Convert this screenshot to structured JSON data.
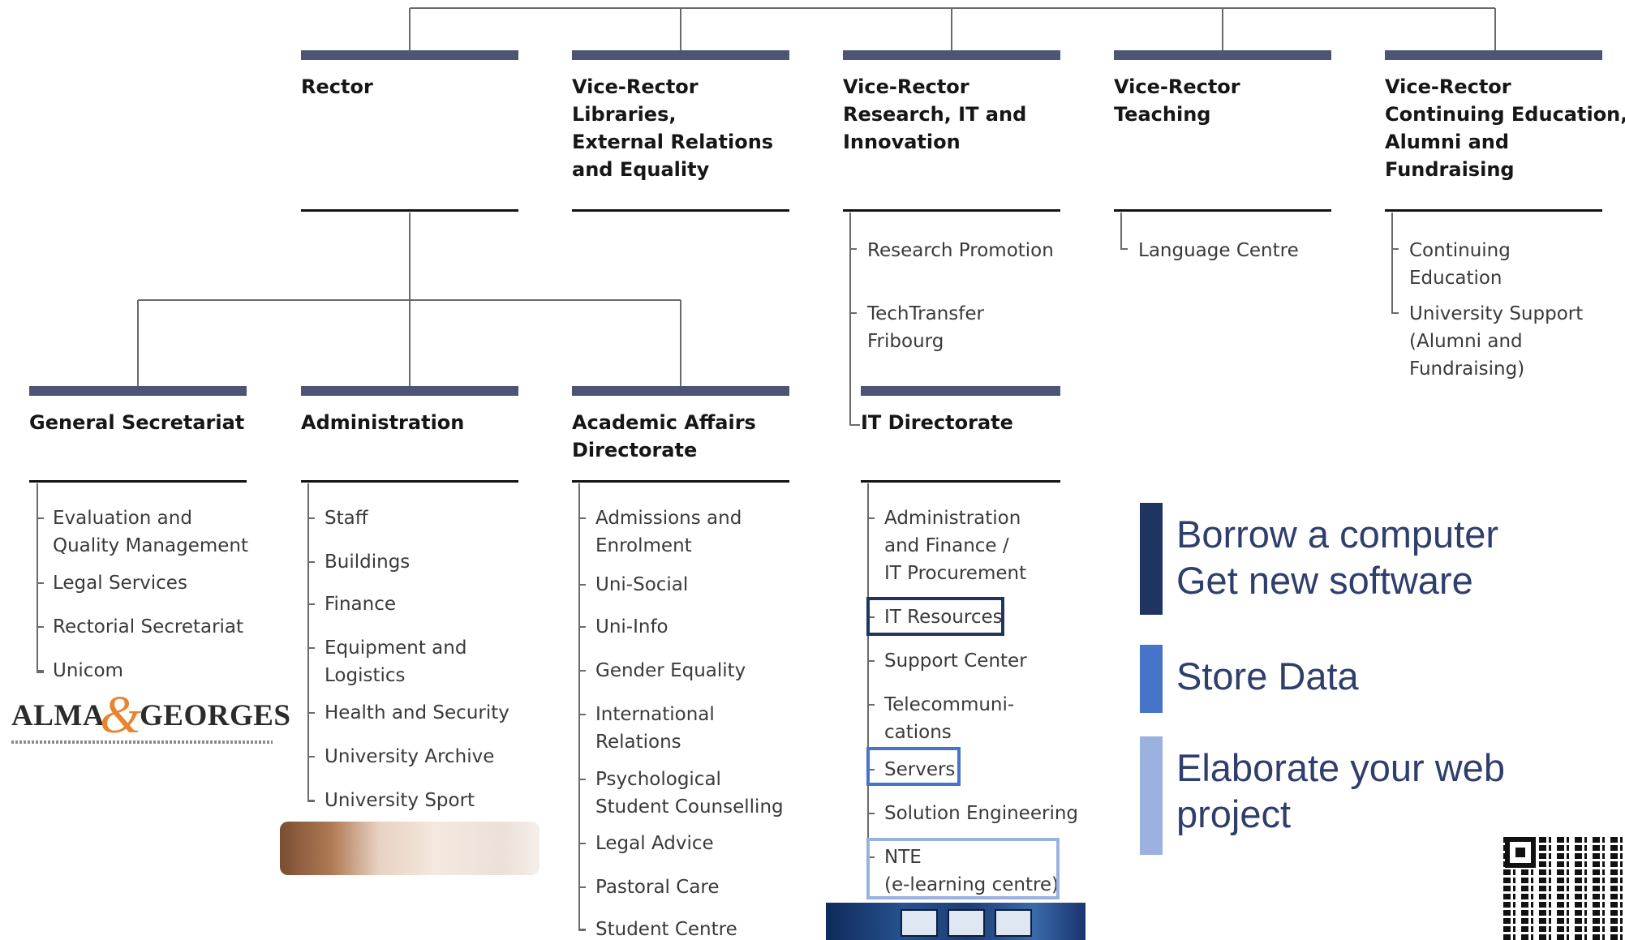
{
  "org_chart": {
    "top_boxes": [
      {
        "title": [
          "Rector"
        ],
        "items": []
      },
      {
        "title": [
          "Vice-Rector",
          "Libraries,",
          "External Relations",
          "and Equality"
        ],
        "items": []
      },
      {
        "title": [
          "Vice-Rector",
          "Research, IT and",
          "Innovation"
        ],
        "items": [
          [
            "Research Promotion"
          ],
          [
            "TechTransfer",
            "Fribourg"
          ]
        ]
      },
      {
        "title": [
          "Vice-Rector",
          "Teaching"
        ],
        "items": [
          [
            "Language Centre"
          ]
        ]
      },
      {
        "title": [
          "Vice-Rector",
          "Continuing Education,",
          "Alumni and",
          "Fundraising"
        ],
        "items": [
          [
            "Continuing",
            "Education"
          ],
          [
            "University Support",
            "(Alumni and",
            "Fundraising)"
          ]
        ]
      }
    ],
    "directorates": [
      {
        "title": [
          "General Secretariat"
        ],
        "items": [
          [
            "Evaluation and",
            "Quality Management"
          ],
          [
            "Legal Services"
          ],
          [
            "Rectorial Secretariat"
          ],
          [
            "Unicom"
          ]
        ]
      },
      {
        "title": [
          "Administration"
        ],
        "items": [
          [
            "Staff"
          ],
          [
            "Buildings"
          ],
          [
            "Finance"
          ],
          [
            "Equipment and",
            "Logistics"
          ],
          [
            "Health and Security"
          ],
          [
            "University Archive"
          ],
          [
            "University Sport"
          ]
        ]
      },
      {
        "title": [
          "Academic Affairs",
          "Directorate"
        ],
        "items": [
          [
            "Admissions and",
            "Enrolment"
          ],
          [
            "Uni-Social"
          ],
          [
            "Uni-Info"
          ],
          [
            "Gender Equality"
          ],
          [
            "International",
            "Relations"
          ],
          [
            "Psychological",
            "Student Counselling"
          ],
          [
            "Legal Advice"
          ],
          [
            "Pastoral Care"
          ],
          [
            "Student Centre"
          ]
        ]
      },
      {
        "title": [
          "IT Directorate"
        ],
        "items": [
          [
            "Administration",
            "and Finance /",
            "IT Procurement"
          ],
          [
            "IT Resources"
          ],
          [
            "Support Center"
          ],
          [
            "Telecommuni-",
            "cations"
          ],
          [
            "Servers"
          ],
          [
            "Solution Engineering"
          ],
          [
            "NTE",
            "(e-learning centre)"
          ]
        ]
      }
    ]
  },
  "legend": [
    {
      "lines": [
        "Borrow a computer",
        "Get new software"
      ],
      "color": "#1f3461"
    },
    {
      "lines": [
        "Store Data"
      ],
      "color": "#4674c8"
    },
    {
      "lines": [
        "Elaborate your web",
        "project"
      ],
      "color": "#9bb1e0"
    }
  ],
  "highlights": [
    {
      "item": "IT Resources",
      "color": "#1f3461"
    },
    {
      "item": "Servers",
      "color": "#4674c8"
    },
    {
      "item": "NTE (e-learning centre)",
      "color": "#9bb1e0"
    }
  ],
  "logo": {
    "left_word": "ALMA",
    "ampersand": "&",
    "right_word": "GEORGES"
  },
  "colors": {
    "bar": "#4d5474",
    "rule": "#111111",
    "text": "#1c1c1c",
    "connector": "#666666"
  }
}
